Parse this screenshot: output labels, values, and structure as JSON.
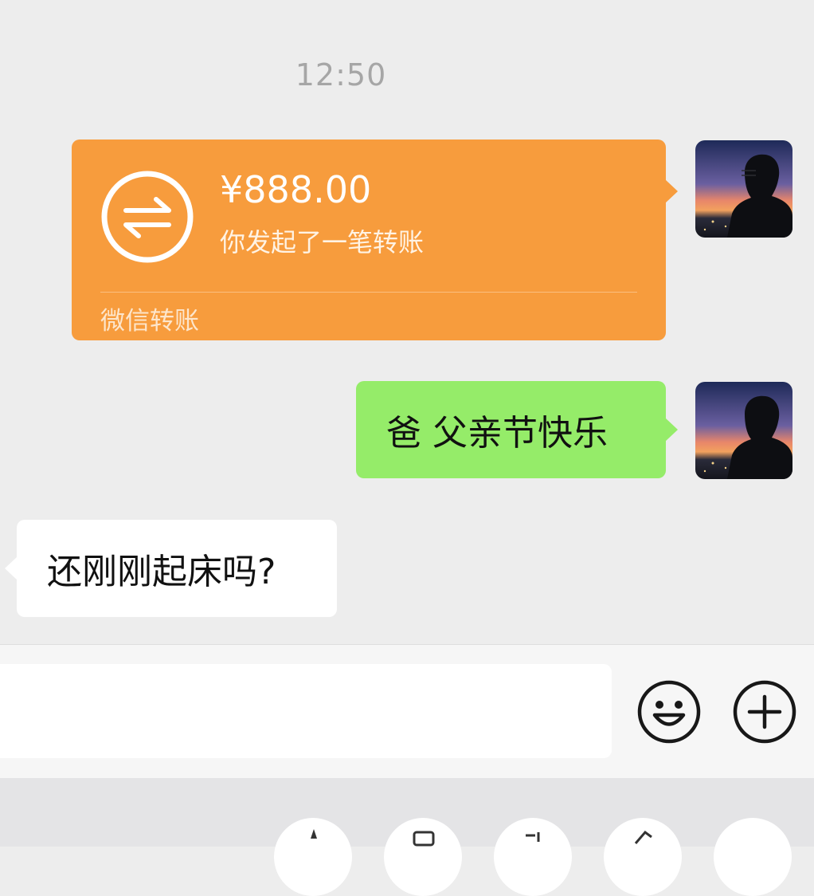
{
  "chat": {
    "timestamp": "12:50",
    "transfer": {
      "amount": "¥888.00",
      "description": "你发起了一笔转账",
      "footer": "微信转账",
      "icon": "transfer-arrows-icon"
    },
    "messages": [
      {
        "direction": "outgoing",
        "text": "爸 父亲节快乐"
      },
      {
        "direction": "incoming",
        "text": "还刚刚起床吗?"
      }
    ]
  },
  "input_bar": {
    "value": "",
    "emoji_icon": "smiley-face-icon",
    "plus_icon": "plus-circle-icon"
  },
  "panel": {
    "items": [
      "favorites-icon",
      "camera-icon",
      "video-call-icon",
      "location-icon",
      "more-icon"
    ]
  },
  "colors": {
    "background": "#ededed",
    "transfer_card": "#f79c3d",
    "outgoing_bubble": "#95ec69",
    "incoming_bubble": "#ffffff"
  }
}
